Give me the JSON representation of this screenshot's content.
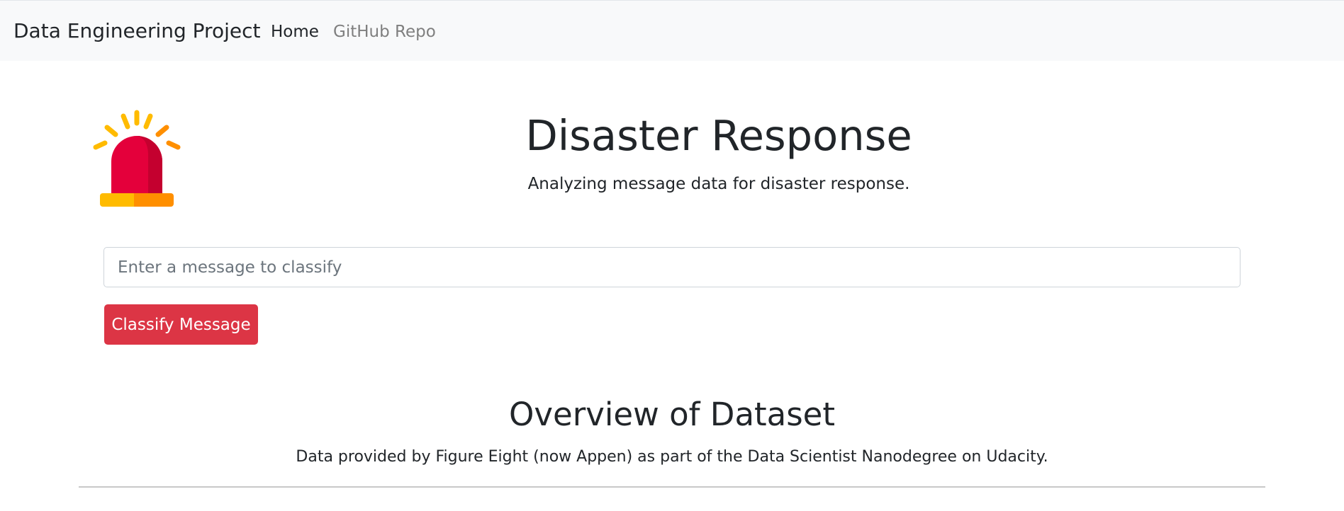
{
  "navbar": {
    "brand": "Data Engineering Project",
    "links": [
      {
        "label": "Home",
        "active": true
      },
      {
        "label": "GitHub Repo",
        "active": false
      }
    ]
  },
  "header": {
    "logo_icon": "siren-alarm-icon",
    "title": "Disaster Response",
    "subtitle": "Analyzing message data for disaster response."
  },
  "form": {
    "input_value": "",
    "input_placeholder": "Enter a message to classify",
    "button_label": "Classify Message"
  },
  "overview": {
    "title": "Overview of Dataset",
    "subtitle": "Data provided by Figure Eight (now Appen) as part of the Data Scientist Nanodegree on Udacity."
  },
  "colors": {
    "navbar_bg": "#f8f9fa",
    "button_bg": "#dc3545",
    "siren_red": "#e4003b",
    "siren_dark_red": "#c4002f",
    "siren_yellow": "#ffbb00",
    "siren_orange": "#ff8f00"
  }
}
